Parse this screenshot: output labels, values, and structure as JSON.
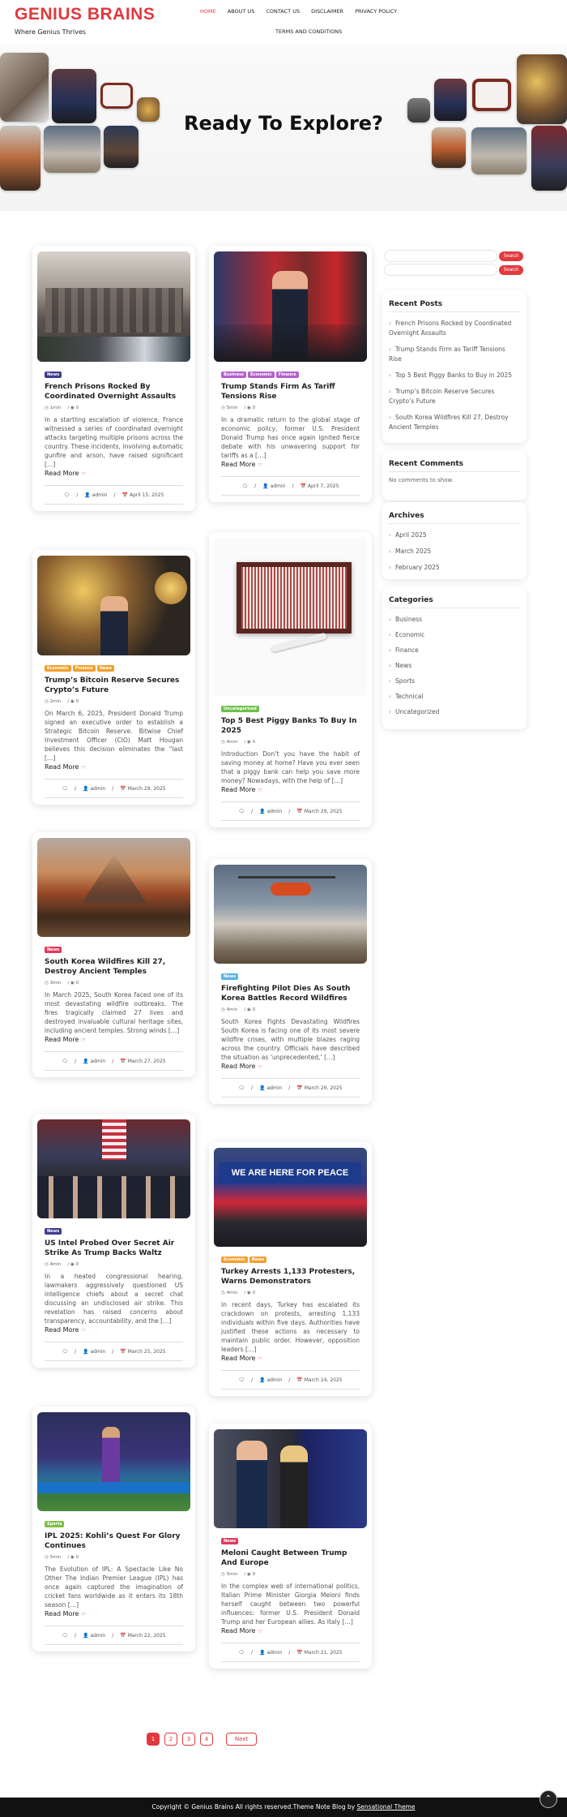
{
  "site": {
    "title": "GENIUS BRAINS",
    "tagline": "Where Genius Thrives"
  },
  "nav": {
    "row1": [
      "HOME",
      "ABOUT US",
      "CONTACT US",
      "DISCLAIMER",
      "PRIVACY POLICY"
    ],
    "row2": [
      "TERMS AND CONDITIONS"
    ],
    "active": "HOME"
  },
  "hero": {
    "title": "Ready To Explore?"
  },
  "common": {
    "read_more": "Read More",
    "author": "admin"
  },
  "category_colors": {
    "News": "#4b3a8c",
    "Business": "#a74fc5",
    "Economic": "#9b59b6",
    "Finance": "#b48be0",
    "Uncategorized": "#6cc04a",
    "Sports": "#7dc242"
  },
  "posts": [
    {
      "title": "French Prisons Rocked By Coordinated Overnight Assaults",
      "categories": [
        {
          "label": "News",
          "color": "#3d3b8e"
        }
      ],
      "read_time": "1min",
      "comments": "0",
      "date": "April 15, 2025",
      "excerpt": "In a startling escalation of violence, France witnessed a series of coordinated overnight attacks targeting multiple prisons across the country. These incidents, involving automatic gunfire and arson, have raised significant […]"
    },
    {
      "title": "Trump Stands Firm As Tariff Tensions Rise",
      "categories": [
        {
          "label": "Business",
          "color": "#b55fd0"
        },
        {
          "label": "Economic",
          "color": "#b55fd0"
        },
        {
          "label": "Finance",
          "color": "#b55fd0"
        }
      ],
      "read_time": "5min",
      "comments": "0",
      "date": "April 7, 2025",
      "excerpt": "In a dramatic return to the global stage of economic policy, former U.S. President Donald Trump has once again ignited fierce debate with his unwavering support for tariffs as a […]"
    },
    {
      "title": "Trump’s Bitcoin Reserve Secures Crypto’s Future",
      "categories": [
        {
          "label": "Economic",
          "color": "#f0a030"
        },
        {
          "label": "Finance",
          "color": "#f0a030"
        },
        {
          "label": "News",
          "color": "#f0a030"
        }
      ],
      "read_time": "2min",
      "comments": "0",
      "date": "March 29, 2025",
      "excerpt": "On March 6, 2025, President Donald Trump signed an executive order to establish a Strategic Bitcoin Reserve. Bitwise Chief Investment Officer (CIO) Matt Hougan believes this decision eliminates the “last […]"
    },
    {
      "title": "Top 5 Best Piggy Banks To Buy In 2025",
      "categories": [
        {
          "label": "Uncategorized",
          "color": "#6cc04a"
        }
      ],
      "read_time": "4min",
      "comments": "0",
      "date": "March 29, 2025",
      "excerpt": "Introduction Don’t you have the habit of saving money at home? Have you ever seen that a piggy bank can help you save more money? Nowadays, with the help of […]"
    },
    {
      "title": "South Korea Wildfires Kill 27, Destroy Ancient Temples",
      "categories": [
        {
          "label": "News",
          "color": "#e0395e"
        }
      ],
      "read_time": "3min",
      "comments": "0",
      "date": "March 27, 2025",
      "excerpt": "In March 2025, South Korea faced one of its most devastating wildfire outbreaks. The fires tragically claimed 27 lives and destroyed invaluable cultural heritage sites, including ancient temples. Strong winds […]"
    },
    {
      "title": "Firefighting Pilot Dies As South Korea Battles Record Wildfires",
      "categories": [
        {
          "label": "News",
          "color": "#5ab4e5"
        }
      ],
      "read_time": "4min",
      "comments": "0",
      "date": "March 26, 2025",
      "excerpt": "South Korea Fights Devastating Wildfires South Korea is facing one of its most severe wildfire crises, with multiple blazes raging across the country. Officials have described the situation as ‘unprecedented,’ […]"
    },
    {
      "title": "US Intel Probed Over Secret Air Strike As Trump Backs Waltz",
      "categories": [
        {
          "label": "News",
          "color": "#3d3b8e"
        }
      ],
      "read_time": "4min",
      "comments": "0",
      "date": "March 25, 2025",
      "excerpt": "In a heated congressional hearing, lawmakers aggressively questioned US intelligence chiefs about a secret chat discussing an undisclosed air strike. This revelation has raised concerns about transparency, accountability, and the […]"
    },
    {
      "title": "Turkey Arrests 1,133 Protesters, Warns Demonstrators",
      "categories": [
        {
          "label": "Economic",
          "color": "#f0a030"
        },
        {
          "label": "News",
          "color": "#f0a030"
        }
      ],
      "read_time": "4min",
      "comments": "0",
      "date": "March 24, 2025",
      "excerpt": "In recent days, Turkey has escalated its crackdown on protests, arresting 1,133 individuals within five days. Authorities have justified these actions as necessary to maintain public order. However, opposition leaders […]"
    },
    {
      "title": "IPL 2025: Kohli’s Quest For Glory Continues",
      "categories": [
        {
          "label": "Sports",
          "color": "#7dc242"
        }
      ],
      "read_time": "5min",
      "comments": "0",
      "date": "March 22, 2025",
      "excerpt": "The Evolution of IPL: A Spectacle Like No Other The Indian Premier League (IPL) has once again captured the imagination of cricket fans worldwide as it enters its 18th season […]"
    },
    {
      "title": "Meloni Caught Between Trump And Europe",
      "categories": [
        {
          "label": "News",
          "color": "#e0395e"
        }
      ],
      "read_time": "5min",
      "comments": "0",
      "date": "March 21, 2025",
      "excerpt": "In the complex web of international politics, Italian Prime Minister Giorgia Meloni finds herself caught between two powerful influences: former U.S. President Donald Trump and her European allies. As Italy […]"
    }
  ],
  "sidebar": {
    "search_button": "Search",
    "recent_posts": {
      "title": "Recent Posts",
      "items": [
        "French Prisons Rocked by Coordinated Overnight Assaults",
        "Trump Stands Firm as Tariff Tensions Rise",
        "Top 5 Best Piggy Banks to Buy in 2025",
        "Trump’s Bitcoin Reserve Secures Crypto’s Future",
        "South Korea Wildfires Kill 27, Destroy Ancient Temples"
      ]
    },
    "recent_comments": {
      "title": "Recent Comments",
      "empty": "No comments to show."
    },
    "archives": {
      "title": "Archives",
      "items": [
        "April 2025",
        "March 2025",
        "February 2025"
      ]
    },
    "categories": {
      "title": "Categories",
      "items": [
        "Business",
        "Economic",
        "Finance",
        "News",
        "Sports",
        "Technical",
        "Uncategorized"
      ]
    }
  },
  "pagination": {
    "pages": [
      "1",
      "2",
      "3",
      "4"
    ],
    "current": "1",
    "next": "Next"
  },
  "footer": {
    "text": "Copyright © Genius Brains All rights reserved.Theme Note Blog by ",
    "link": "Sensational Theme"
  }
}
